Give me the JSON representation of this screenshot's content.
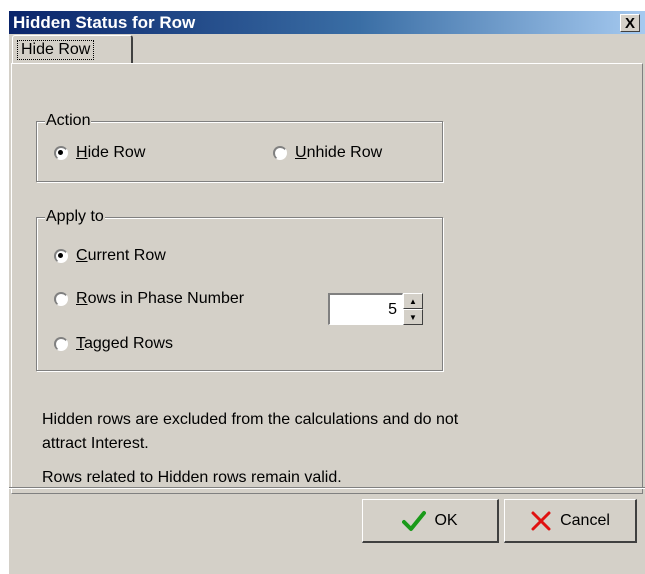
{
  "window": {
    "title": "Hidden Status for Row",
    "close_label": "X"
  },
  "tabs": [
    {
      "label": "Hide Row",
      "selected": true
    }
  ],
  "action_group": {
    "label": "Action",
    "options": [
      {
        "prefix": "",
        "accel": "H",
        "rest": "ide Row",
        "checked": true
      },
      {
        "prefix": "",
        "accel": "U",
        "rest": "nhide Row",
        "checked": false
      }
    ]
  },
  "apply_group": {
    "label": "Apply to",
    "options": [
      {
        "prefix": "",
        "accel": "C",
        "rest": "urrent Row",
        "checked": true
      },
      {
        "prefix": "",
        "accel": "R",
        "rest": "ows in Phase Number",
        "checked": false
      },
      {
        "prefix": "",
        "accel": "T",
        "rest": "agged Rows",
        "checked": false
      }
    ],
    "phase_number": "5"
  },
  "info": {
    "line1": "Hidden rows are excluded from the calculations and do not",
    "line2": "attract Interest.",
    "line3": "Rows related to Hidden rows remain valid."
  },
  "buttons": {
    "ok_label": "OK",
    "cancel_label": "Cancel"
  },
  "colors": {
    "dialog_bg": "#d4d0c8",
    "title_start": "#0a246a",
    "title_end": "#a6caf0",
    "ok_icon": "#1a9a1a",
    "cancel_icon": "#e01010"
  },
  "icons": {
    "ok": "checkmark-icon",
    "cancel": "x-icon"
  }
}
